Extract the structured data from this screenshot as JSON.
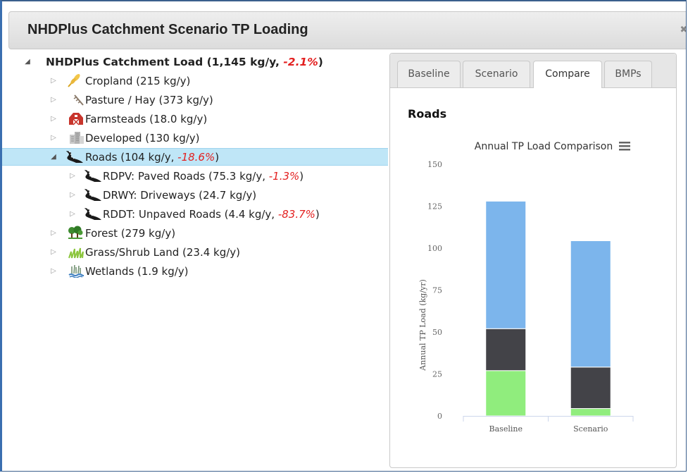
{
  "window": {
    "title": "NHDPlus Catchment Scenario TP Loading",
    "close_icon": "close-icon"
  },
  "tree": {
    "root": {
      "label": "NHDPlus Catchment Load (1,145 kg/y, ",
      "change": "-2.1%",
      "close": ")"
    },
    "items": [
      {
        "label": "Cropland (215 kg/y)",
        "icon": "wheat-icon"
      },
      {
        "label": "Pasture / Hay (373 kg/y)",
        "icon": "feather-icon"
      },
      {
        "label": "Farmsteads (18.0 kg/y)",
        "icon": "barn-icon"
      },
      {
        "label": "Developed (130 kg/y)",
        "icon": "buildings-icon"
      },
      {
        "label": "Roads (104 kg/y, ",
        "change": "-18.6%",
        "close": ")",
        "icon": "road-icon"
      },
      {
        "label": "RDPV: Paved Roads (75.3 kg/y, ",
        "change": "-1.3%",
        "close": ")",
        "icon": "road-icon"
      },
      {
        "label": "DRWY: Driveways (24.7 kg/y)",
        "icon": "road-icon"
      },
      {
        "label": "RDDT: Unpaved Roads (4.4 kg/y, ",
        "change": "-83.7%",
        "close": ")",
        "icon": "road-icon"
      },
      {
        "label": "Forest (279 kg/y)",
        "icon": "trees-icon"
      },
      {
        "label": "Grass/Shrub Land (23.4 kg/y)",
        "icon": "grass-icon"
      },
      {
        "label": "Wetlands (1.9 kg/y)",
        "icon": "wetland-icon"
      }
    ]
  },
  "panel": {
    "tabs": [
      "Baseline",
      "Scenario",
      "Compare",
      "BMPs"
    ],
    "active_tab": "Compare",
    "heading": "Roads",
    "menu_icon": "hamburger-menu-icon"
  },
  "colors": {
    "paved": "#7cb5ec",
    "driveways": "#434348",
    "unpaved": "#90ed7d",
    "negative": "#e32020",
    "selected_row": "#bfe6f7"
  },
  "chart_data": {
    "type": "bar",
    "stacked": true,
    "title": "Annual TP Load Comparison",
    "ylabel": "Annual TP Load (kg/yr)",
    "xlabel": "",
    "categories": [
      "Baseline",
      "Scenario"
    ],
    "ylim": [
      0,
      150
    ],
    "yticks": [
      0,
      25,
      50,
      75,
      100,
      125,
      150
    ],
    "grid": false,
    "legend": "none",
    "series": [
      {
        "values": [
          27,
          4.4
        ],
        "color": "#90ed7d"
      },
      {
        "values": [
          25,
          24.7
        ],
        "color": "#434348"
      },
      {
        "values": [
          76,
          75.3
        ],
        "color": "#7cb5ec"
      }
    ]
  }
}
